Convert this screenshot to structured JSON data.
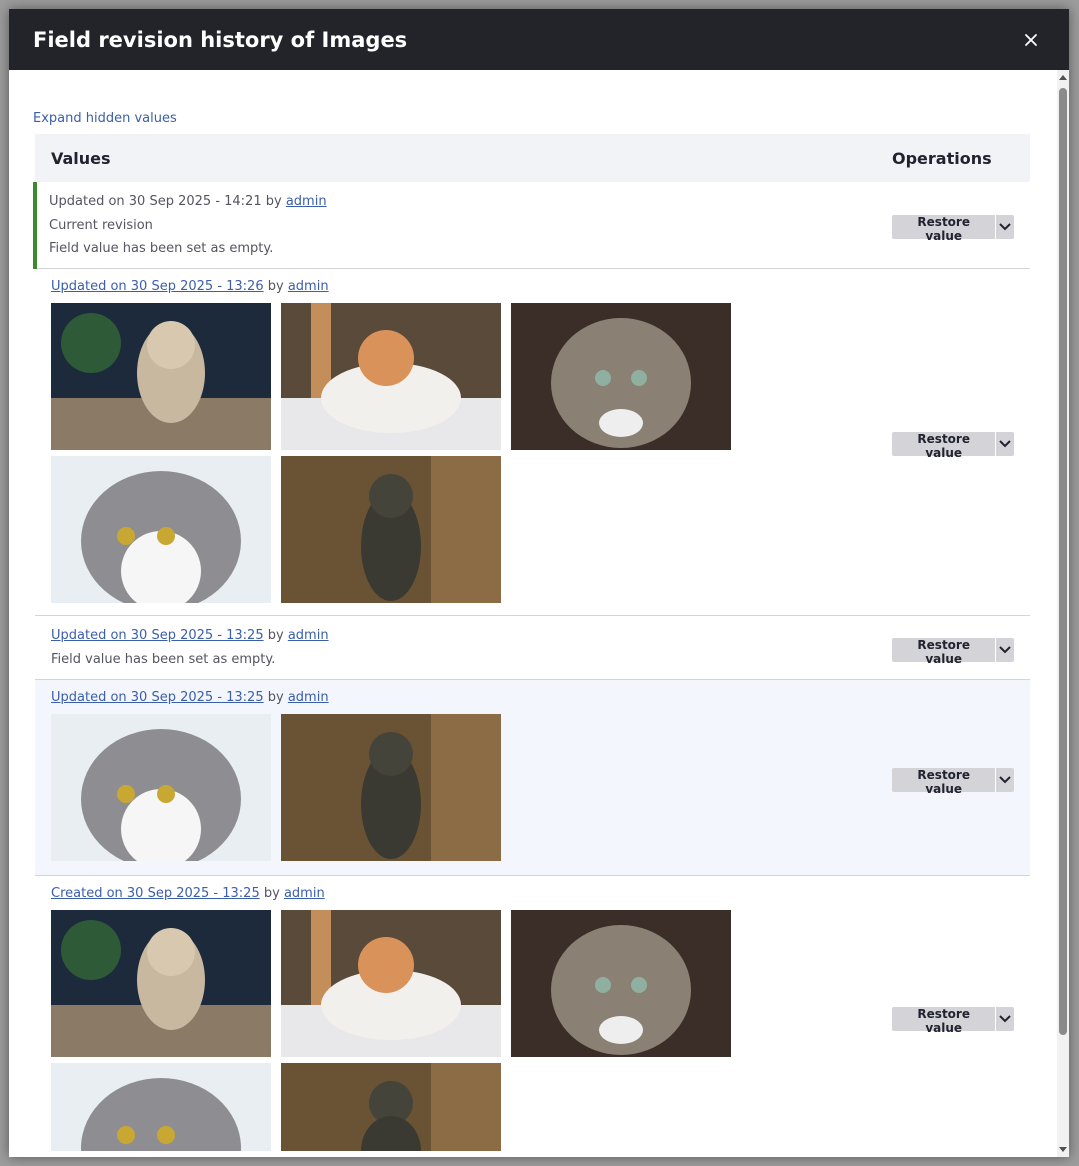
{
  "dialog": {
    "title": "Field revision history of Images",
    "close_icon": "close-icon"
  },
  "expand_link": "Expand hidden values",
  "table": {
    "headers": {
      "values": "Values",
      "operations": "Operations"
    },
    "restore_label": "Restore value",
    "rows": [
      {
        "prefix": "Updated on 30 Sep 2025 - 14:21",
        "by": "by",
        "user": "admin",
        "line1": "Current revision",
        "line2": "Field value has been set as empty."
      },
      {
        "link": "Updated on 30 Sep 2025 - 13:26",
        "by": "by",
        "user": "admin",
        "images": [
          "kitten-praying",
          "orange-white-kitten",
          "tabby-cat-looking-up",
          "grey-white-cat",
          "kitten-standing"
        ]
      },
      {
        "link": "Updated on 30 Sep 2025 - 13:25",
        "by": "by",
        "user": "admin",
        "line1": "Field value has been set as empty."
      },
      {
        "link": "Updated on 30 Sep 2025 - 13:25",
        "by": "by",
        "user": "admin",
        "images": [
          "grey-white-cat",
          "kitten-standing"
        ]
      },
      {
        "link": "Created on 30 Sep 2025 - 13:25",
        "by": "by",
        "user": "admin",
        "images": [
          "kitten-praying",
          "orange-white-kitten",
          "tabby-cat-looking-up",
          "grey-white-cat",
          "kitten-standing"
        ]
      }
    ]
  }
}
